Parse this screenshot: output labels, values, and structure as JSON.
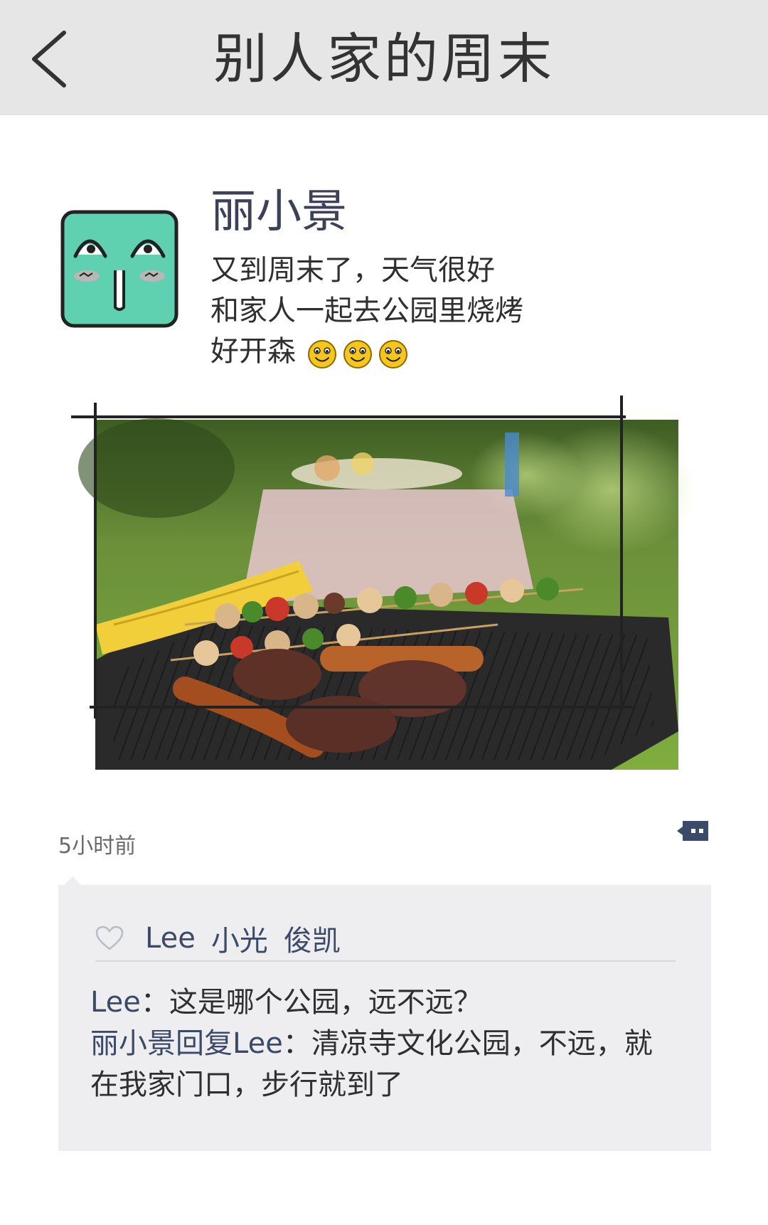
{
  "header": {
    "title": "别人家的周末",
    "back_icon": "chevron-left-icon"
  },
  "post": {
    "author": "丽小景",
    "lines": [
      "又到周末了，天气很好",
      "和家人一起去公园里烧烤",
      "好开森"
    ],
    "emojis": [
      "smile-emoji",
      "smile-emoji",
      "smile-emoji"
    ],
    "time": "5小时前",
    "image": "barbecue-photo"
  },
  "likes": {
    "icon": "heart-icon",
    "users": [
      "Lee",
      "小光",
      "俊凯"
    ]
  },
  "comments": [
    {
      "author": "Lee",
      "sep": "：",
      "text": "这是哪个公园，远不远？"
    },
    {
      "author": "丽小景",
      "reply_word": "回复",
      "reply_to": "Lee",
      "sep": "：",
      "text": "清凉寺文化公园，不远，就在我家门口，步行就到了"
    }
  ],
  "colors": {
    "header_bg": "#e6e6e6",
    "avatar_green": "#5fd0b0",
    "name_blue": "#3c4a6a",
    "comment_bg": "#eeeef0"
  }
}
